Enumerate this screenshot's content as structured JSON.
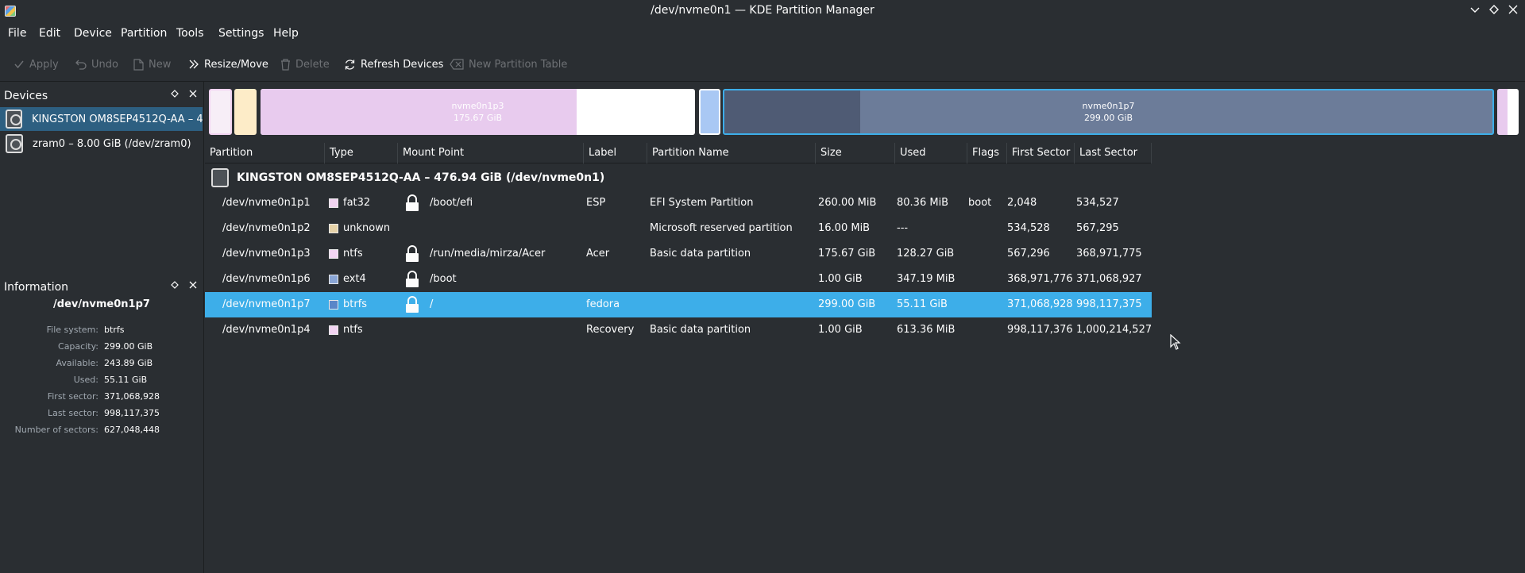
{
  "window": {
    "title": "/dev/nvme0n1 — KDE Partition Manager"
  },
  "menu": [
    "File",
    "Edit",
    "Device",
    "Partition",
    "Tools",
    "Settings",
    "Help"
  ],
  "toolbar": {
    "apply": "Apply",
    "undo": "Undo",
    "new": "New",
    "resize_move": "Resize/Move",
    "delete": "Delete",
    "refresh": "Refresh Devices",
    "new_table": "New Partition Table"
  },
  "devices_panel": {
    "title": "Devices",
    "items": [
      {
        "label": "KINGSTON OM8SEP4512Q-AA – 4...",
        "selected": true
      },
      {
        "label": "zram0 – 8.00 GiB (/dev/zram0)",
        "selected": false
      }
    ]
  },
  "info_panel": {
    "title": "Information",
    "heading": "/dev/nvme0n1p7",
    "rows": [
      {
        "key": "File system:",
        "value": "btrfs"
      },
      {
        "key": "Capacity:",
        "value": "299.00 GiB"
      },
      {
        "key": "Available:",
        "value": "243.89 GiB"
      },
      {
        "key": "Used:",
        "value": "55.11 GiB"
      },
      {
        "key": "First sector:",
        "value": "371,068,928"
      },
      {
        "key": "Last sector:",
        "value": "998,117,375"
      },
      {
        "key": "Number of sectors:",
        "value": "627,048,448"
      }
    ]
  },
  "partition_bar": {
    "p3_name": "nvme0n1p3",
    "p3_size": "175.67 GiB",
    "p7_name": "nvme0n1p7",
    "p7_size": "299.00 GiB"
  },
  "table": {
    "columns": [
      "Partition",
      "Type",
      "Mount Point",
      "Label",
      "Partition Name",
      "Size",
      "Used",
      "Flags",
      "First Sector",
      "Last Sector"
    ],
    "device_header": "KINGSTON OM8SEP4512Q-AA – 476.94 GiB (/dev/nvme0n1)",
    "rows": [
      {
        "partition": "/dev/nvme0n1p1",
        "type": "fat32",
        "type_color": "#f2d4f2",
        "mount": "/boot/efi",
        "locked": true,
        "label": "ESP",
        "pname": "EFI System Partition",
        "size": "260.00 MiB",
        "used": "80.36 MiB",
        "flags": "boot",
        "first": "2,048",
        "last": "534,527"
      },
      {
        "partition": "/dev/nvme0n1p2",
        "type": "unknown",
        "type_color": "#e6d2a8",
        "mount": "",
        "locked": false,
        "label": "",
        "pname": "Microsoft reserved partition",
        "size": "16.00 MiB",
        "used": "---",
        "flags": "",
        "first": "534,528",
        "last": "567,295"
      },
      {
        "partition": "/dev/nvme0n1p3",
        "type": "ntfs",
        "type_color": "#f2d4f2",
        "mount": "/run/media/mirza/Acer",
        "locked": true,
        "label": "Acer",
        "pname": "Basic data partition",
        "size": "175.67 GiB",
        "used": "128.27 GiB",
        "flags": "",
        "first": "567,296",
        "last": "368,971,775"
      },
      {
        "partition": "/dev/nvme0n1p6",
        "type": "ext4",
        "type_color": "#8aa6d6",
        "mount": "/boot",
        "locked": true,
        "label": "",
        "pname": "",
        "size": "1.00 GiB",
        "used": "347.19 MiB",
        "flags": "",
        "first": "368,971,776",
        "last": "371,068,927"
      },
      {
        "partition": "/dev/nvme0n1p7",
        "type": "btrfs",
        "type_color": "#5a86c8",
        "mount": "/",
        "locked": true,
        "label": "fedora",
        "pname": "",
        "size": "299.00 GiB",
        "used": "55.11 GiB",
        "flags": "",
        "first": "371,068,928",
        "last": "998,117,375"
      },
      {
        "partition": "/dev/nvme0n1p4",
        "type": "ntfs",
        "type_color": "#f2d4f2",
        "mount": "",
        "locked": false,
        "label": "Recovery",
        "pname": "Basic data partition",
        "size": "1.00 GiB",
        "used": "613.36 MiB",
        "flags": "",
        "first": "998,117,376",
        "last": "1,000,214,527"
      }
    ]
  },
  "colors": {
    "background": "#2a2e32",
    "selection": "#3daee9",
    "device_selected": "#2d5f81"
  }
}
